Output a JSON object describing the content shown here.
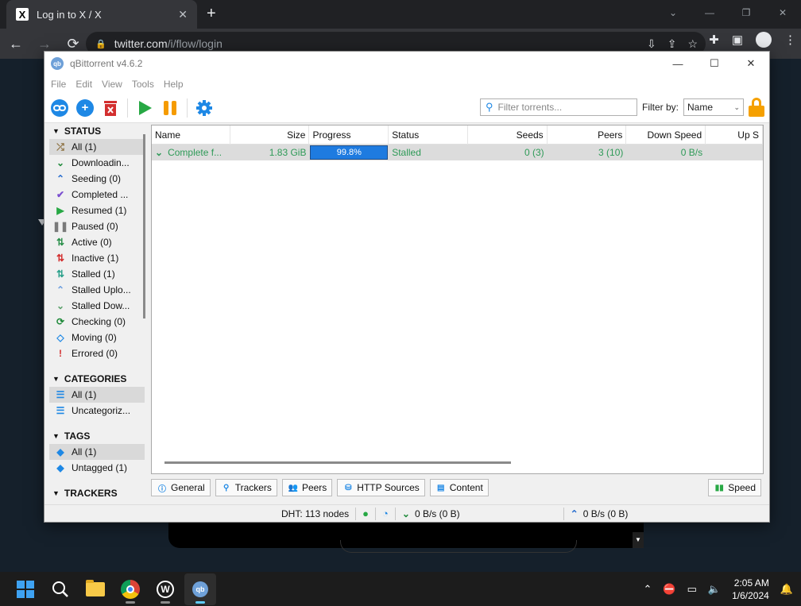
{
  "browser": {
    "tab_title": "Log in to X / X",
    "tab_logo": "X",
    "url_host": "twitter.com",
    "url_path": "/i/flow/login"
  },
  "qb": {
    "title": "qBittorrent v4.6.2",
    "app_icon_text": "qb",
    "menu": [
      "File",
      "Edit",
      "View",
      "Tools",
      "Help"
    ],
    "filter_placeholder": "Filter torrents...",
    "filter_by_label": "Filter by:",
    "filter_by_value": "Name",
    "status_header": "STATUS",
    "status_items": [
      {
        "label": "All (1)",
        "icon": "shuffle-icon",
        "glyph": "⤮",
        "color": "#8a6d3b",
        "selected": true
      },
      {
        "label": "Downloadin...",
        "icon": "download-icon",
        "glyph": "⌄",
        "color": "#1f8a3a"
      },
      {
        "label": "Seeding (0)",
        "icon": "upload-icon",
        "glyph": "⌃",
        "color": "#2a6fcf"
      },
      {
        "label": "Completed ...",
        "icon": "check-icon",
        "glyph": "✔",
        "color": "#7b4fd0"
      },
      {
        "label": "Resumed (1)",
        "icon": "play-icon",
        "glyph": "▶",
        "color": "#27a844"
      },
      {
        "label": "Paused (0)",
        "icon": "pause-icon",
        "glyph": "❚❚",
        "color": "#7a7a7a"
      },
      {
        "label": "Active (0)",
        "icon": "active-arrows-icon",
        "glyph": "⇅",
        "color": "#2a8f4a"
      },
      {
        "label": "Inactive (1)",
        "icon": "inactive-arrows-icon",
        "glyph": "⇅",
        "color": "#d32f2f"
      },
      {
        "label": "Stalled (1)",
        "icon": "stalled-arrows-icon",
        "glyph": "⇅",
        "color": "#2aa08a"
      },
      {
        "label": "Stalled Uplo...",
        "icon": "stalled-upload-icon",
        "glyph": "⌃",
        "color": "#6fa0e0"
      },
      {
        "label": "Stalled Dow...",
        "icon": "stalled-download-icon",
        "glyph": "⌄",
        "color": "#5aa06a"
      },
      {
        "label": "Checking (0)",
        "icon": "refresh-icon",
        "glyph": "⟳",
        "color": "#1f8a3a"
      },
      {
        "label": "Moving (0)",
        "icon": "move-icon",
        "glyph": "◇",
        "color": "#1e88e5"
      },
      {
        "label": "Errored (0)",
        "icon": "error-icon",
        "glyph": "!",
        "color": "#d32f2f"
      }
    ],
    "categories_header": "CATEGORIES",
    "category_items": [
      {
        "label": "All (1)",
        "icon": "list-icon",
        "selected": true
      },
      {
        "label": "Uncategoriz...",
        "icon": "list-icon"
      }
    ],
    "tags_header": "TAGS",
    "tag_items": [
      {
        "label": "All (1)",
        "icon": "tag-icon",
        "selected": true
      },
      {
        "label": "Untagged (1)",
        "icon": "tag-icon"
      }
    ],
    "trackers_header": "TRACKERS",
    "columns": [
      "Name",
      "Size",
      "Progress",
      "Status",
      "Seeds",
      "Peers",
      "Down Speed",
      "Up S"
    ],
    "torrents": [
      {
        "name": "Complete f...",
        "size": "1.83 GiB",
        "progress_text": "99.8%",
        "progress_fraction": 0.998,
        "status": "Stalled",
        "seeds": "0 (3)",
        "peers": "3 (10)",
        "down_speed": "0 B/s"
      }
    ],
    "bottom_tabs": [
      "General",
      "Trackers",
      "Peers",
      "HTTP Sources",
      "Content"
    ],
    "speed_tab": "Speed",
    "statusbar": {
      "dht": "DHT: 113 nodes",
      "down": "0 B/s (0 B)",
      "up": "0 B/s (0 B)"
    }
  },
  "taskbar": {
    "time": "2:05 AM",
    "date": "1/6/2024",
    "wp_letter": "W",
    "qb_letter": "qb"
  }
}
